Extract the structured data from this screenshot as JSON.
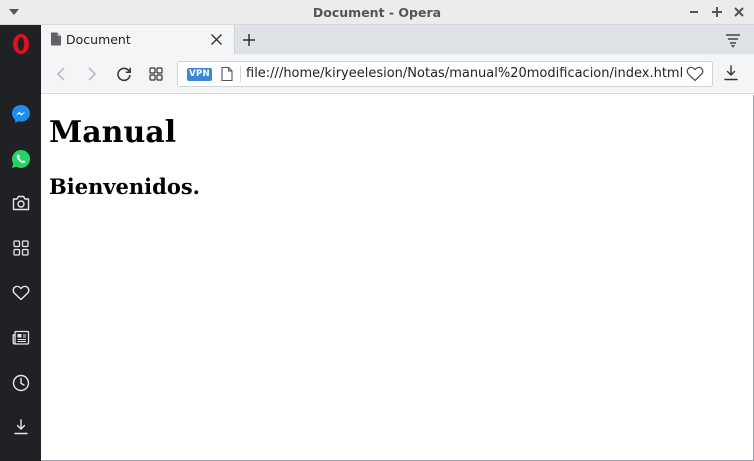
{
  "window": {
    "title": "Document - Opera"
  },
  "tabs": [
    {
      "label": "Document",
      "active": true
    }
  ],
  "navbar": {
    "vpn_badge": "VPN",
    "url": "file:///home/kiryeelesion/Notas/manual%20modificacion/index.html"
  },
  "sidebar": {
    "items": [
      {
        "icon": "opera-logo-icon"
      },
      {
        "icon": "messenger-icon"
      },
      {
        "icon": "whatsapp-icon"
      },
      {
        "icon": "camera-icon"
      },
      {
        "icon": "speed-dial-icon"
      },
      {
        "icon": "heart-icon"
      },
      {
        "icon": "news-icon"
      },
      {
        "icon": "history-icon"
      },
      {
        "icon": "download-icon"
      }
    ]
  },
  "page": {
    "heading": "Manual",
    "subheading": "Bienvenidos."
  },
  "colors": {
    "sidebar_bg": "#1f2124",
    "vpn_badge": "#3b86d8",
    "opera_red": "#e0101e",
    "messenger_blue": "#1f8cf0",
    "whatsapp_green": "#25d366"
  }
}
